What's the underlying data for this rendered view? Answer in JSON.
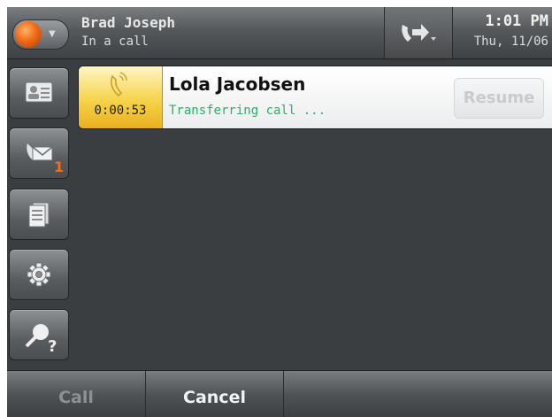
{
  "status_bar": {
    "user_name": "Brad Joseph",
    "user_status": "In a call",
    "time": "1:01 PM",
    "date": "Thu, 11/06",
    "presence_color": "#f06a16"
  },
  "sidebar": {
    "items": [
      {
        "name": "contacts",
        "icon": "contact-card-icon"
      },
      {
        "name": "messages",
        "icon": "voicemail-envelope-icon",
        "badge": "1"
      },
      {
        "name": "directory",
        "icon": "directory-list-icon"
      },
      {
        "name": "settings",
        "icon": "gear-icon"
      },
      {
        "name": "help",
        "icon": "help-magnifier-icon"
      }
    ]
  },
  "call": {
    "timer": "0:00:53",
    "contact_name": "Lola Jacobsen",
    "state": "Transferring call ...",
    "resume_label": "Resume",
    "state_color": "#29b06a"
  },
  "softkeys": {
    "call_label": "Call",
    "cancel_label": "Cancel"
  }
}
